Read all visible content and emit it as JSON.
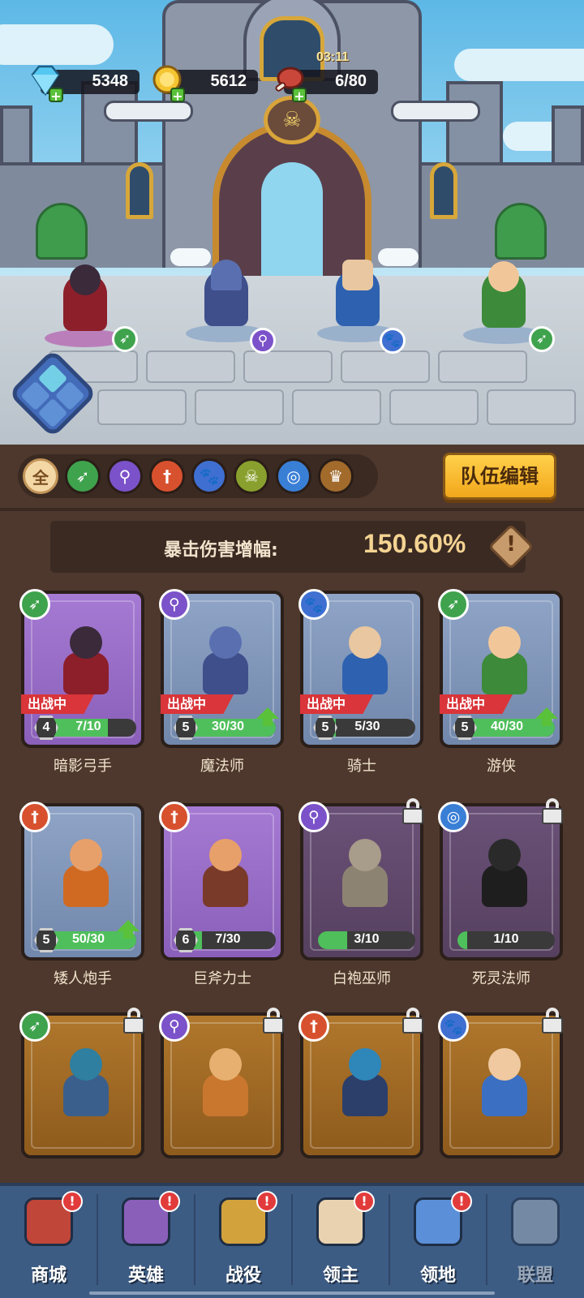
{
  "resources": {
    "gems": "5348",
    "gold": "5612",
    "stamina": "6/80",
    "stamina_timer": "03:11"
  },
  "field_heroes": [
    {
      "name": "暗影弓手",
      "class_icon": "bow-icon",
      "class_color": "#3fa34d"
    },
    {
      "name": "魔法师",
      "class_icon": "staff-icon",
      "class_color": "#7b52c9"
    },
    {
      "name": "骑士",
      "class_icon": "paw-icon",
      "class_color": "#3f6fd1"
    },
    {
      "name": "游侠",
      "class_icon": "bow-icon",
      "class_color": "#3fa34d"
    }
  ],
  "filters": [
    {
      "label": "全",
      "icon": "all-icon",
      "color": "#f3d7a5"
    },
    {
      "label": "",
      "icon": "bow-icon",
      "color": "#3fa34d"
    },
    {
      "label": "",
      "icon": "staff-icon",
      "color": "#7b52c9"
    },
    {
      "label": "",
      "icon": "sword-icon",
      "color": "#d8512e"
    },
    {
      "label": "",
      "icon": "paw-icon",
      "color": "#3f6fd1"
    },
    {
      "label": "",
      "icon": "skull-icon",
      "color": "#8aa02e"
    },
    {
      "label": "",
      "icon": "swirl-icon",
      "color": "#3a7fd6"
    },
    {
      "label": "",
      "icon": "crown-icon",
      "color": "#a26a2b"
    }
  ],
  "team_edit_label": "队伍编辑",
  "crit": {
    "label": "暴击伤害增幅:",
    "value": "150.60%"
  },
  "hero_cards": [
    {
      "name": "暗影弓手",
      "level": "4",
      "progress": "7/10",
      "fill": 0.7,
      "deployed": true,
      "locked": false,
      "upgrade": false,
      "frame": "purple",
      "class_icon": "bow-icon",
      "class_color": "#3fa34d",
      "art_color": "#3a2a3a",
      "cloak_color": "#8c1f2a"
    },
    {
      "name": "魔法师",
      "level": "5",
      "progress": "30/30",
      "fill": 1.0,
      "deployed": true,
      "locked": false,
      "upgrade": true,
      "frame": "blue",
      "class_icon": "staff-icon",
      "class_color": "#7b52c9",
      "art_color": "#5a6fb0",
      "cloak_color": "#3f4f8c"
    },
    {
      "name": "骑士",
      "level": "5",
      "progress": "5/30",
      "fill": 0.17,
      "deployed": true,
      "locked": false,
      "upgrade": false,
      "frame": "blue",
      "class_icon": "paw-icon",
      "class_color": "#3f6fd1",
      "art_color": "#e9c7a0",
      "cloak_color": "#2e62b0"
    },
    {
      "name": "游侠",
      "level": "5",
      "progress": "40/30",
      "fill": 1.0,
      "deployed": true,
      "locked": false,
      "upgrade": true,
      "frame": "blue",
      "class_icon": "bow-icon",
      "class_color": "#3fa34d",
      "art_color": "#f1c79a",
      "cloak_color": "#3c8a3a"
    },
    {
      "name": "矮人炮手",
      "level": "5",
      "progress": "50/30",
      "fill": 1.0,
      "deployed": false,
      "locked": false,
      "upgrade": true,
      "frame": "blue",
      "class_icon": "sword-icon",
      "class_color": "#d8512e",
      "art_color": "#e8a06a",
      "cloak_color": "#d06a22"
    },
    {
      "name": "巨斧力士",
      "level": "6",
      "progress": "7/30",
      "fill": 0.23,
      "deployed": false,
      "locked": false,
      "upgrade": false,
      "frame": "purple",
      "class_icon": "sword-icon",
      "class_color": "#d8512e",
      "art_color": "#e8a06a",
      "cloak_color": "#7a3a2a"
    },
    {
      "name": "白袍巫师",
      "level": "",
      "progress": "3/10",
      "fill": 0.3,
      "deployed": false,
      "locked": true,
      "upgrade": false,
      "frame": "dark",
      "class_icon": "staff-icon",
      "class_color": "#7b52c9",
      "art_color": "#a89c8a",
      "cloak_color": "#8d8372"
    },
    {
      "name": "死灵法师",
      "level": "",
      "progress": "1/10",
      "fill": 0.1,
      "deployed": false,
      "locked": true,
      "upgrade": false,
      "frame": "dark",
      "class_icon": "swirl-icon",
      "class_color": "#3a7fd6",
      "art_color": "#2a2a2a",
      "cloak_color": "#1e1e1e"
    },
    {
      "name": "",
      "level": "",
      "progress": "",
      "fill": 0,
      "deployed": false,
      "locked": true,
      "upgrade": false,
      "frame": "gold",
      "class_icon": "bow-icon",
      "class_color": "#3fa34d",
      "art_color": "#2f7fa0",
      "cloak_color": "#3a5f8c"
    },
    {
      "name": "",
      "level": "",
      "progress": "",
      "fill": 0,
      "deployed": false,
      "locked": true,
      "upgrade": false,
      "frame": "gold",
      "class_icon": "staff-icon",
      "class_color": "#7b52c9",
      "art_color": "#e8b070",
      "cloak_color": "#c9772f"
    },
    {
      "name": "",
      "level": "",
      "progress": "",
      "fill": 0,
      "deployed": false,
      "locked": true,
      "upgrade": false,
      "frame": "gold",
      "class_icon": "sword-icon",
      "class_color": "#d8512e",
      "art_color": "#2f86b8",
      "cloak_color": "#2c3f6a"
    },
    {
      "name": "",
      "level": "",
      "progress": "",
      "fill": 0,
      "deployed": false,
      "locked": true,
      "upgrade": false,
      "frame": "gold",
      "class_icon": "paw-icon",
      "class_color": "#3f6fd1",
      "art_color": "#f0c9a0",
      "cloak_color": "#3b6fc2"
    }
  ],
  "nav": [
    {
      "label": "商城",
      "icon": "shop-chest-icon",
      "alert": "!",
      "enabled": true,
      "color": "#c0463a"
    },
    {
      "label": "英雄",
      "icon": "hero-cards-icon",
      "alert": "!",
      "enabled": true,
      "color": "#8a5fb9"
    },
    {
      "label": "战役",
      "icon": "crossed-swords-icon",
      "alert": "!",
      "enabled": true,
      "color": "#d2a23c"
    },
    {
      "label": "领主",
      "icon": "lord-crown-icon",
      "alert": "!",
      "enabled": true,
      "color": "#e9d2b0"
    },
    {
      "label": "领地",
      "icon": "castle-icon",
      "alert": "!",
      "enabled": true,
      "color": "#5b8fd8"
    },
    {
      "label": "联盟",
      "icon": "alliance-icon",
      "alert": "",
      "enabled": false,
      "color": "#9aa8ba"
    }
  ]
}
